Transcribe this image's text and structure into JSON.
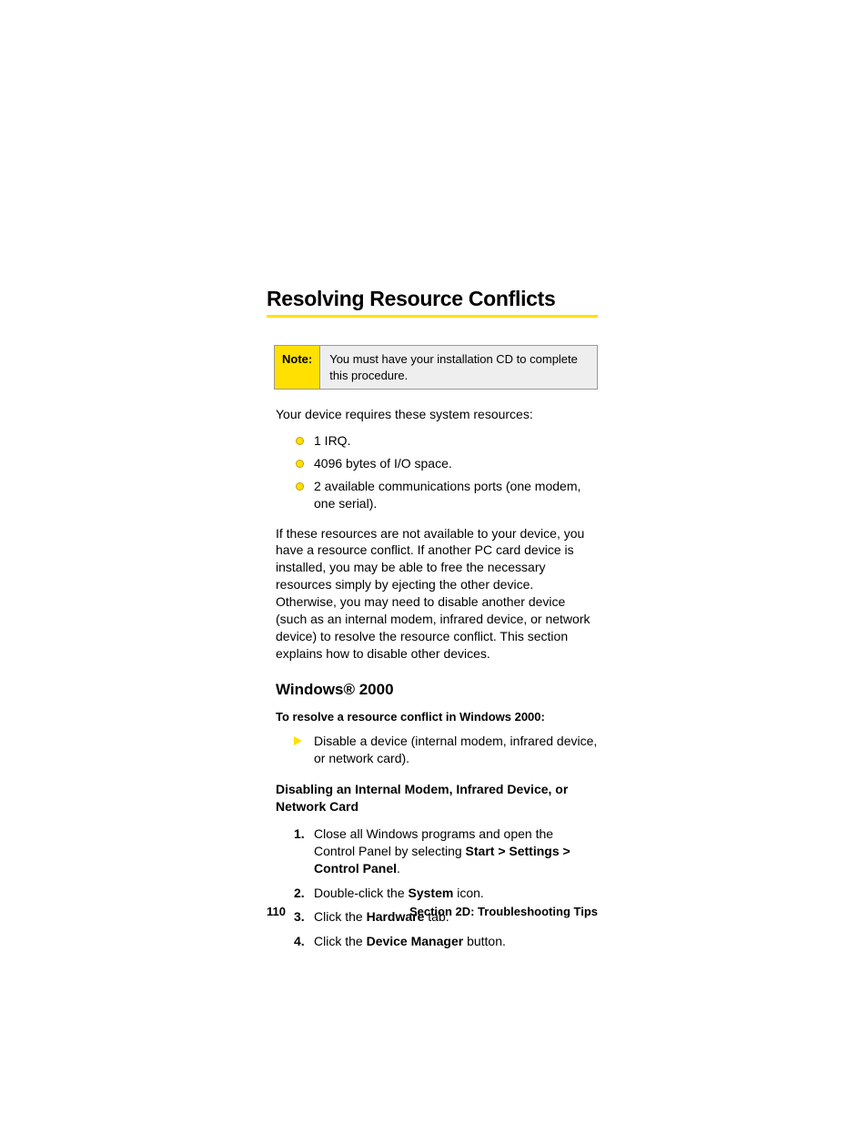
{
  "title": "Resolving Resource Conflicts",
  "note": {
    "label": "Note:",
    "text": "You must have your installation CD to complete this procedure."
  },
  "intro": "Your device requires these system resources:",
  "resources": [
    "1 IRQ.",
    "4096 bytes of I/O space.",
    "2 available communications ports (one modem, one serial)."
  ],
  "conflict_paragraph": "If these resources are not available to your device, you have a resource conflict. If another PC card device is installed, you may be able to free the necessary resources simply by ejecting the other device. Otherwise, you may need to disable another device (such as an internal modem, infrared device, or network device) to resolve the resource conflict. This section explains how to disable other devices.",
  "subheading": "Windows® 2000",
  "lead": "To resolve a resource conflict in Windows 2000:",
  "arrow_item": "Disable a device (internal modem, infrared device, or network card).",
  "disable_heading": "Disabling an Internal Modem, Infrared Device, or Network Card",
  "steps": {
    "s1_a": "Close all Windows programs and open the Control Panel by selecting ",
    "s1_b": "Start > Settings > Control Panel",
    "s1_c": ".",
    "s2_a": "Double-click the ",
    "s2_b": "System",
    "s2_c": " icon.",
    "s3_a": "Click the ",
    "s3_b": "Hardware",
    "s3_c": " tab.",
    "s4_a": "Click the ",
    "s4_b": "Device Manager",
    "s4_c": " button."
  },
  "footer": {
    "page": "110",
    "section": "Section 2D: Troubleshooting Tips"
  }
}
